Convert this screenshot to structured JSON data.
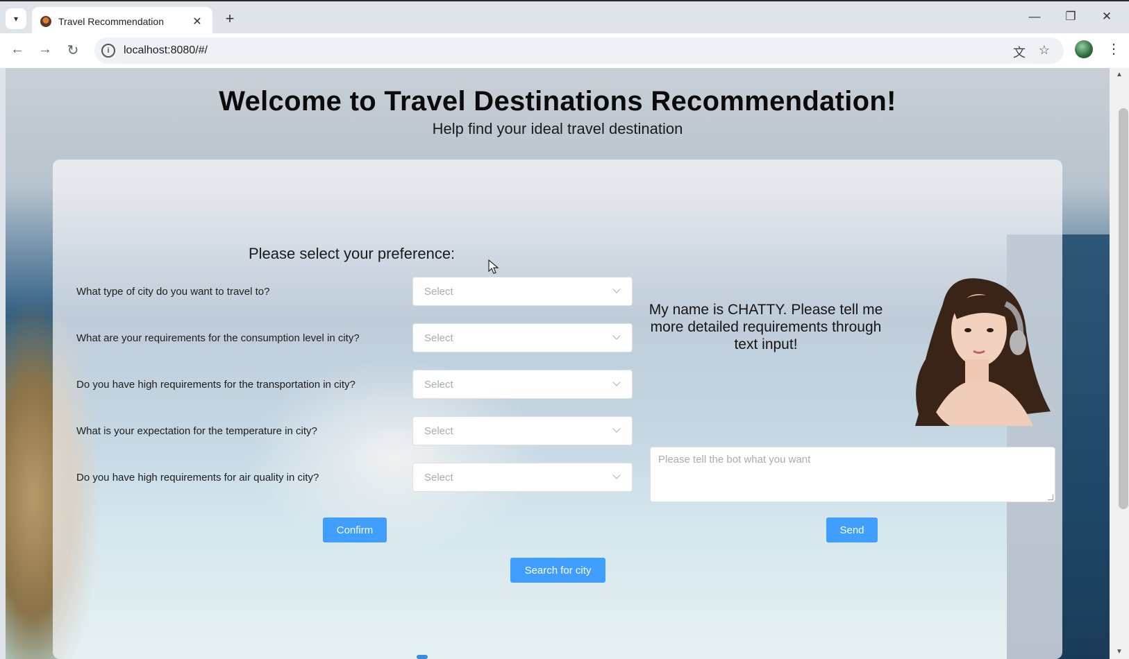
{
  "browser": {
    "tab_title": "Travel Recommendation",
    "tab_close": "✕",
    "new_tab": "+",
    "url": "localhost:8080/#/",
    "icons": [
      "tab-search-icon",
      "favicon-icon",
      "close-icon",
      "new-tab-icon",
      "minimize-icon",
      "restore-icon",
      "window-close-icon",
      "back-icon",
      "forward-icon",
      "reload-icon",
      "info-icon",
      "translate-icon",
      "star-icon",
      "profile-icon",
      "menu-icon"
    ]
  },
  "page": {
    "title": "Welcome to Travel Destinations Recommendation!",
    "subtitle": "Help find your ideal travel destination",
    "preference_heading": "Please select your preference:",
    "questions": [
      {
        "label": "What type of city do you want to travel to?",
        "placeholder": "Select"
      },
      {
        "label": "What are your requirements for the consumption level in city?",
        "placeholder": "Select"
      },
      {
        "label": "Do you have high requirements for the transportation in city?",
        "placeholder": "Select"
      },
      {
        "label": "What is your expectation for the temperature in city?",
        "placeholder": "Select"
      },
      {
        "label": "Do you have high requirements for air quality in city?",
        "placeholder": "Select"
      }
    ],
    "confirm_label": "Confirm",
    "search_label": "Search for city",
    "chat": {
      "intro": "My name is CHATTY. Please tell me more detailed requirements through text input!",
      "input_placeholder": "Please tell the bot what you want",
      "send_label": "Send"
    }
  },
  "colors": {
    "primary_button": "#409eff",
    "title_text": "#0b0b0b",
    "placeholder": "#a8abb2"
  }
}
